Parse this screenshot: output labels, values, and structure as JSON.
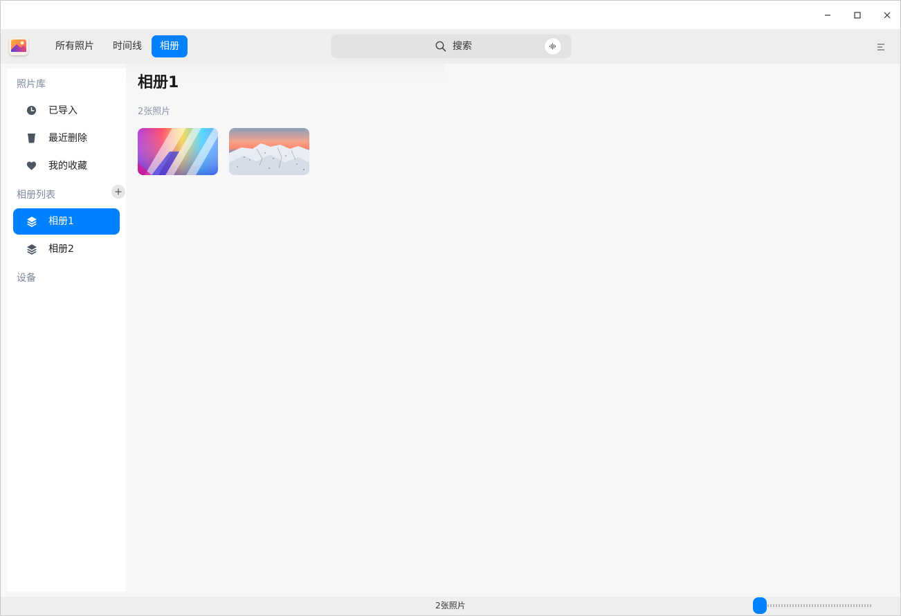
{
  "colors": {
    "accent": "#0081ff",
    "section_title": "#7e8aa0",
    "toolbar_bg": "#eeeeee",
    "content_bg": "#f7f7f7"
  },
  "titlebar": {
    "icons": [
      "minimize-icon",
      "maximize-icon",
      "close-icon"
    ]
  },
  "toolbar": {
    "app_icon": "photo-app-icon",
    "tabs": [
      {
        "label": "所有照片",
        "active": false
      },
      {
        "label": "时间线",
        "active": false
      },
      {
        "label": "相册",
        "active": true
      }
    ],
    "search": {
      "label": "搜索",
      "icon": "search-icon",
      "voice_icon": "voice-icon"
    },
    "menu_icon": "hamburger-menu-icon"
  },
  "sidebar": {
    "library_title": "照片库",
    "library_items": [
      {
        "label": "已导入",
        "icon": "clock-icon"
      },
      {
        "label": "最近删除",
        "icon": "trash-icon"
      },
      {
        "label": "我的收藏",
        "icon": "heart-icon"
      }
    ],
    "albums_title": "相册列表",
    "albums_add_icon": "plus-icon",
    "albums": [
      {
        "label": "相册1",
        "icon": "layers-icon",
        "active": true
      },
      {
        "label": "相册2",
        "icon": "layers-icon",
        "active": false
      }
    ],
    "devices_title": "设备"
  },
  "main": {
    "album_title": "相册1",
    "photo_count": "2张照片",
    "photos": [
      {
        "name": "colorful-gradient-photo"
      },
      {
        "name": "snowy-mountain-photo"
      }
    ]
  },
  "statusbar": {
    "text": "2张照片",
    "zoom_level": 0
  }
}
